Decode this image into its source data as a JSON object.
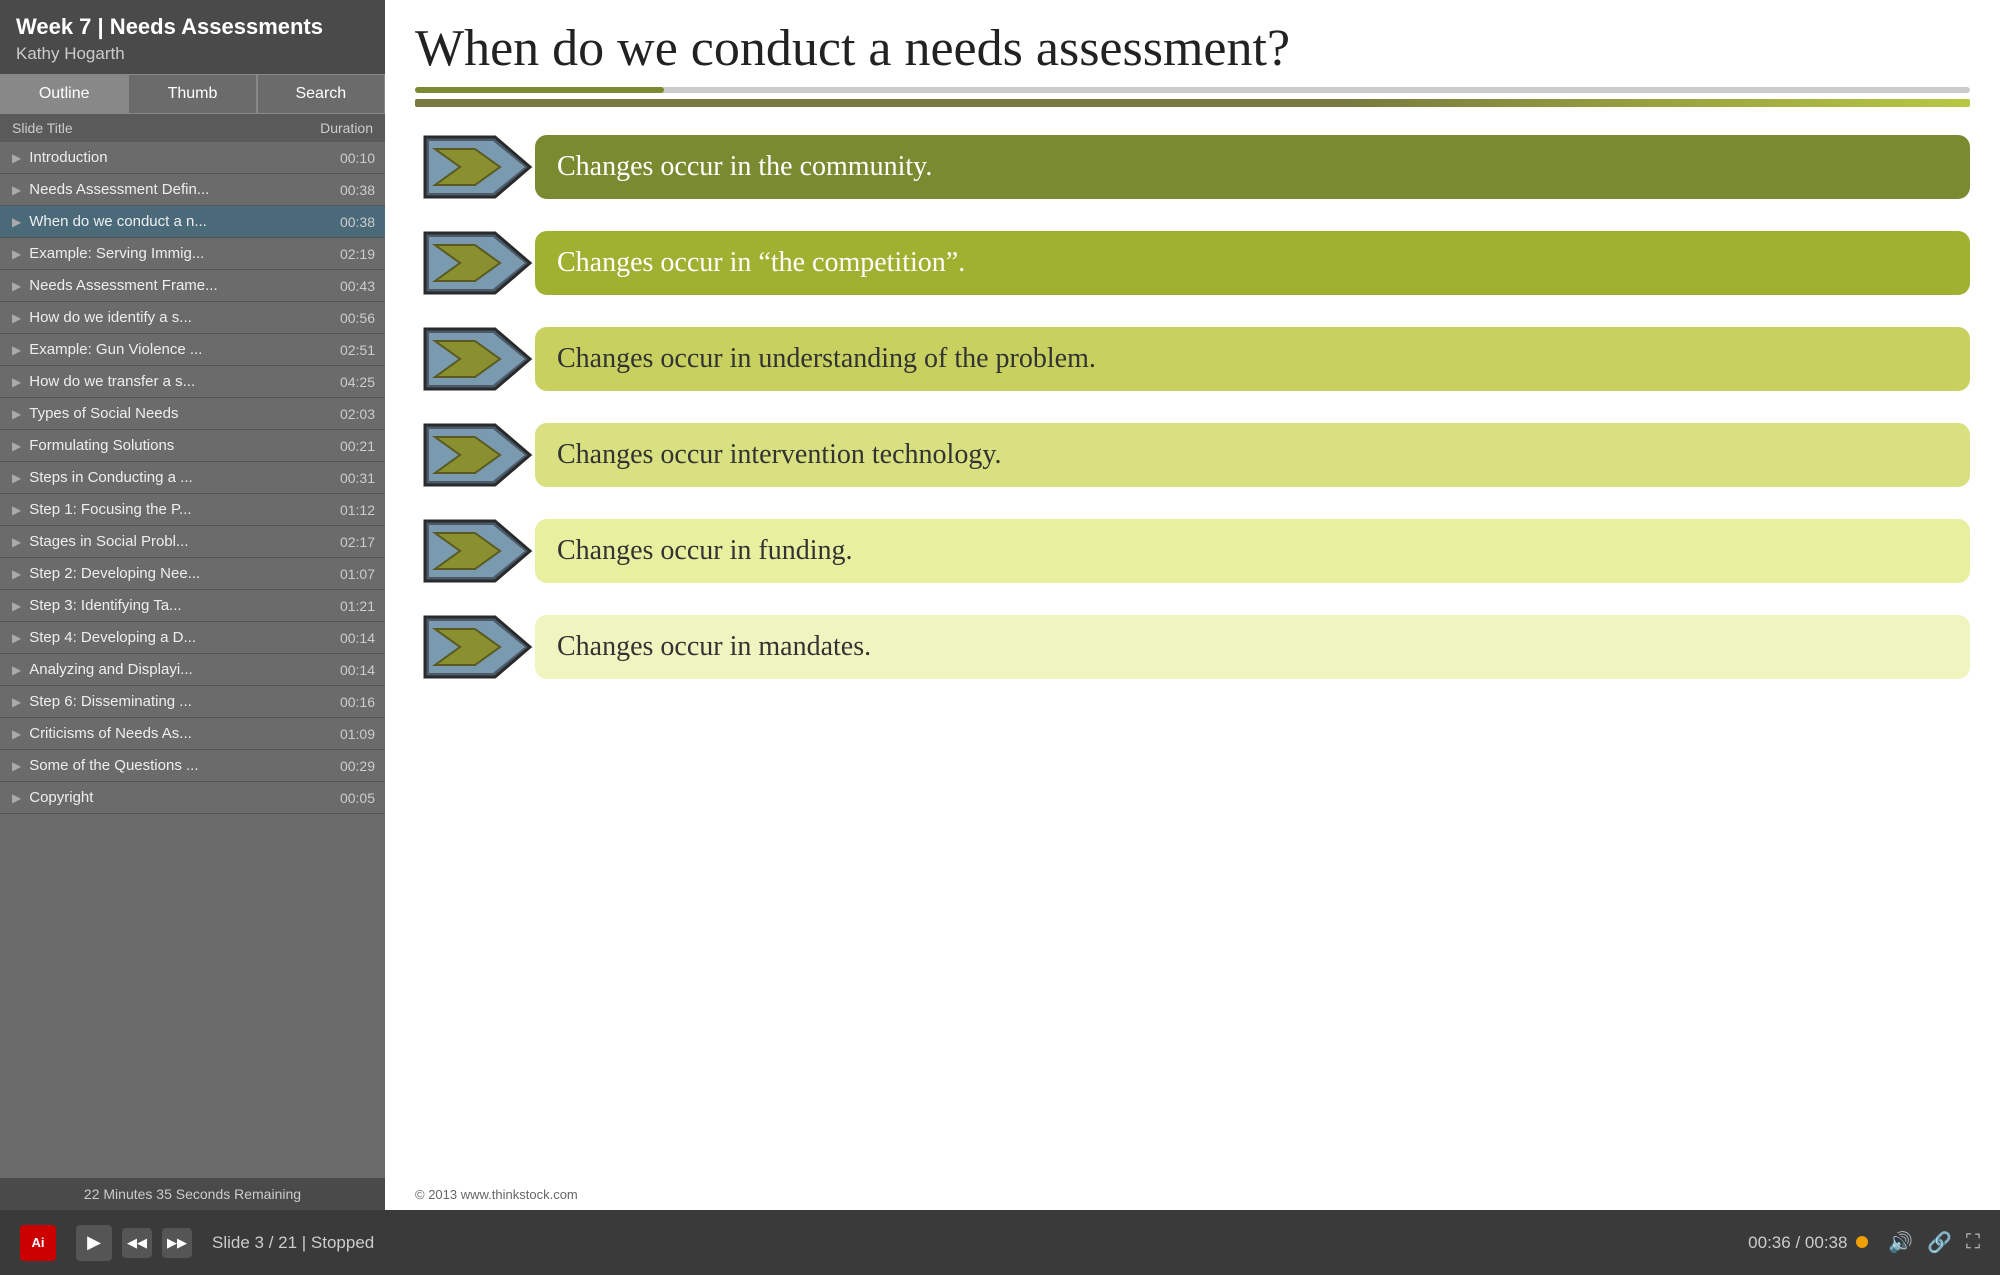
{
  "sidebar": {
    "title": "Week 7 | Needs Assessments",
    "subtitle": "Kathy Hogarth",
    "tabs": [
      {
        "label": "Outline",
        "active": true
      },
      {
        "label": "Thumb",
        "active": false
      },
      {
        "label": "Search",
        "active": false
      }
    ],
    "col_title": "Slide Title",
    "col_duration": "Duration",
    "items": [
      {
        "title": "Introduction",
        "duration": "00:10",
        "active": false
      },
      {
        "title": "Needs Assessment Defin...",
        "duration": "00:38",
        "active": false
      },
      {
        "title": "When do we conduct a n...",
        "duration": "00:38",
        "active": true
      },
      {
        "title": "Example: Serving Immig...",
        "duration": "02:19",
        "active": false
      },
      {
        "title": "Needs Assessment Frame...",
        "duration": "00:43",
        "active": false
      },
      {
        "title": "How do we identify a s...",
        "duration": "00:56",
        "active": false
      },
      {
        "title": "Example: Gun Violence ...",
        "duration": "02:51",
        "active": false
      },
      {
        "title": "How do we transfer a s...",
        "duration": "04:25",
        "active": false
      },
      {
        "title": "Types of Social Needs",
        "duration": "02:03",
        "active": false
      },
      {
        "title": "Formulating Solutions",
        "duration": "00:21",
        "active": false
      },
      {
        "title": "Steps in Conducting a ...",
        "duration": "00:31",
        "active": false
      },
      {
        "title": "Step 1: Focusing the P...",
        "duration": "01:12",
        "active": false
      },
      {
        "title": "Stages in Social Probl...",
        "duration": "02:17",
        "active": false
      },
      {
        "title": "Step 2: Developing Nee...",
        "duration": "01:07",
        "active": false
      },
      {
        "title": "Step 3: Identifying Ta...",
        "duration": "01:21",
        "active": false
      },
      {
        "title": "Step 4: Developing a D...",
        "duration": "00:14",
        "active": false
      },
      {
        "title": "Analyzing and Displayi...",
        "duration": "00:14",
        "active": false
      },
      {
        "title": "Step 6: Disseminating ...",
        "duration": "00:16",
        "active": false
      },
      {
        "title": "Criticisms of Needs As...",
        "duration": "01:09",
        "active": false
      },
      {
        "title": "Some of the Questions ...",
        "duration": "00:29",
        "active": false
      },
      {
        "title": "Copyright",
        "duration": "00:05",
        "active": false
      }
    ],
    "footer": "22 Minutes 35 Seconds Remaining"
  },
  "content": {
    "title": "When do we conduct a needs assessment?",
    "copyright": "© 2013 www.thinkstock.com",
    "items": [
      {
        "text": "Changes occur in the community.",
        "box_class": "box-1"
      },
      {
        "text": "Changes occur in “the competition”.",
        "box_class": "box-2"
      },
      {
        "text": "Changes occur in understanding of the problem.",
        "box_class": "box-3"
      },
      {
        "text": "Changes occur intervention technology.",
        "box_class": "box-4"
      },
      {
        "text": "Changes occur in funding.",
        "box_class": "box-5"
      },
      {
        "text": "Changes occur in mandates.",
        "box_class": "box-6"
      }
    ]
  },
  "player": {
    "slide_info": "Slide 3 / 21 | Stopped",
    "time_current": "00:36",
    "time_total": "00:38",
    "adobe_label": "Ai"
  }
}
